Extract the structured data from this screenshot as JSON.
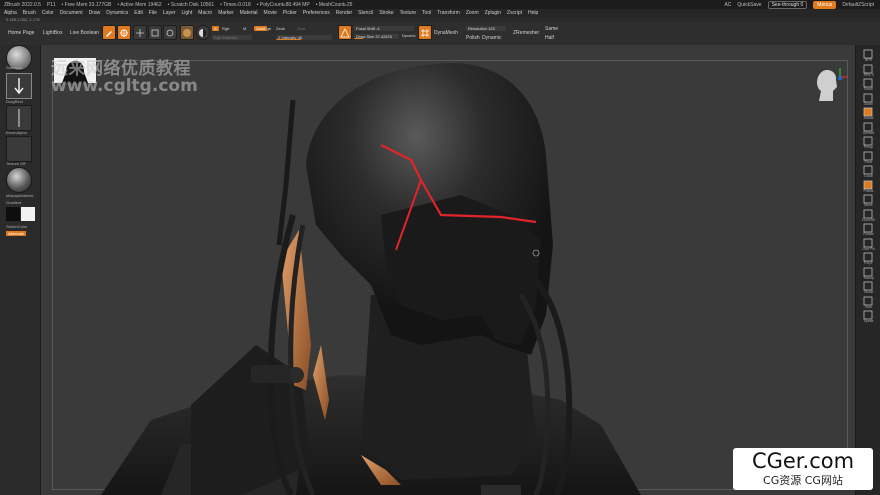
{
  "title_bar": {
    "app": "ZBrush 2022.0.5",
    "file": "P11",
    "free_mem": "• Free Mem 33.177GB",
    "active_mem": "• Active Mem 19462",
    "scratch_disk": "• Scratch Disk 10561",
    "timer": "• Timer▹0.018",
    "poly_count": "• PolyCount▹88.494 MP",
    "mesh_count": "• MeshCount▹25",
    "ac": "AC",
    "quicksave": "QuickSave",
    "see_through": "See-through 0",
    "menus": "Menus",
    "default_script": "DefaultZScript"
  },
  "menu": [
    "Alpha",
    "Brush",
    "Color",
    "Document",
    "Draw",
    "Dynamics",
    "Edit",
    "File",
    "Layer",
    "Light",
    "Macro",
    "Marker",
    "Material",
    "Movie",
    "Picker",
    "Preferences",
    "Render",
    "Stencil",
    "Stroke",
    "Texture",
    "Tool",
    "Transform",
    "Zoom",
    "Zplugin",
    "Zscript",
    "Help"
  ],
  "subline": "0.185,1.052,-1.178",
  "toolbar": {
    "home_page": "Home Page",
    "lightbox": "LightBox",
    "live_boolean": "Live Boolean",
    "edit": "Edit",
    "draw": "Draw",
    "move": "Move",
    "scale": "Scale",
    "rotate": "Rotate",
    "a_label": "A",
    "rgb": "Rgb",
    "m_label": "M",
    "mrgb": "Mrgb",
    "zadd": "Zadd",
    "zsub": "Zsub",
    "zcut": "Zcut",
    "rgb_intensity": "Rgb Intensity",
    "z_intensity": "Z Intensity 45",
    "focal_shift": "Focal Shift -4",
    "draw_size": "Draw Size 37.42876",
    "dynamic": "Dynamic",
    "dynamesh": "DynaMesh",
    "resolution": "Resolution 128",
    "polish": "Polish",
    "dynamic2": "Dynamic",
    "zremesher": "ZRemesher",
    "same": "Same",
    "half": "Half"
  },
  "left_panel": {
    "standard": "Standard",
    "dragrect": "DragRect",
    "brush_alpha": "BrushAlpha",
    "texture_off": "Texture Off",
    "matcap": "MatcapMaterial",
    "gradient": "Gradient",
    "switch_color": "SwitchColor",
    "alternate": "Alternate"
  },
  "right_panel": [
    "BPR",
    "SPix 3",
    "Scroll",
    "Zoom",
    "Actual",
    "AAHalf",
    "Persp",
    "Floor",
    "Local",
    "Frame",
    "Move",
    "Zoom3D",
    "Rotate",
    "Line Fill",
    "PolyF",
    "Transp",
    "Ghost",
    "Solo",
    "Xpose"
  ],
  "watermark": {
    "line1": "远来网络优质教程",
    "line2": "www.cgltg.com"
  },
  "cger_badge": {
    "line1": "CGer.com",
    "line2": "CG资源 CG网站"
  },
  "colors": {
    "accent": "#e07a1f",
    "panel": "#2a2a2a",
    "viewport": "#3a3a3a",
    "red_line": "#e0242b",
    "copper": "#c07a43"
  }
}
